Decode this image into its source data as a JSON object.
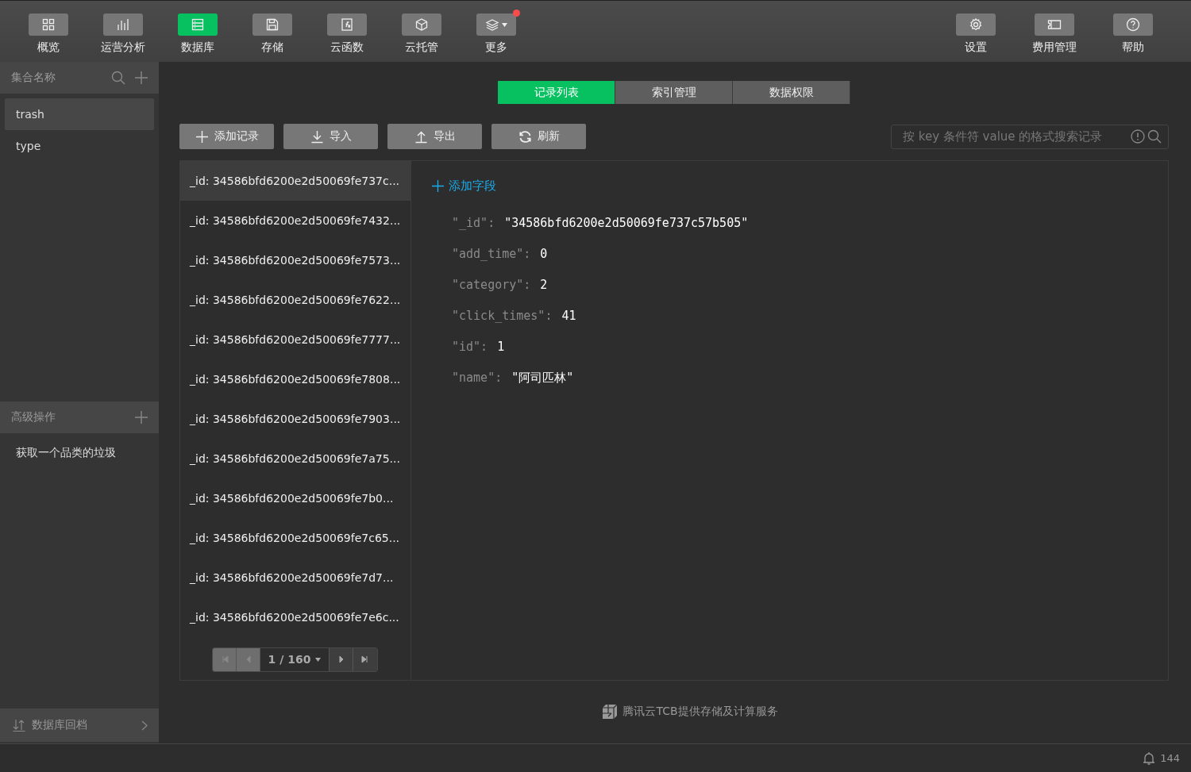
{
  "toolbar": {
    "left": [
      {
        "label": "概览",
        "selected": false,
        "badge": false,
        "dropdown": false
      },
      {
        "label": "运营分析",
        "selected": false,
        "badge": false,
        "dropdown": false
      },
      {
        "label": "数据库",
        "selected": true,
        "badge": false,
        "dropdown": false
      },
      {
        "label": "存储",
        "selected": false,
        "badge": false,
        "dropdown": false
      },
      {
        "label": "云函数",
        "selected": false,
        "badge": false,
        "dropdown": false
      },
      {
        "label": "云托管",
        "selected": false,
        "badge": false,
        "dropdown": false
      },
      {
        "label": "更多",
        "selected": false,
        "badge": true,
        "dropdown": true
      }
    ],
    "right": [
      {
        "label": "设置",
        "selected": false,
        "badge": false,
        "dropdown": false
      },
      {
        "label": "费用管理",
        "selected": false,
        "badge": false,
        "dropdown": false
      },
      {
        "label": "帮助",
        "selected": false,
        "badge": false,
        "dropdown": false
      }
    ]
  },
  "sidebar": {
    "collections_header": "集合名称",
    "collections": [
      {
        "label": "trash",
        "selected": true
      },
      {
        "label": "type",
        "selected": false
      }
    ],
    "advanced_header": "高级操作",
    "advanced": [
      {
        "label": "获取一个品类的垃圾",
        "selected": false
      }
    ],
    "rollback": "数据库回档"
  },
  "tabs": [
    {
      "label": "记录列表",
      "selected": true
    },
    {
      "label": "索引管理",
      "selected": false
    },
    {
      "label": "数据权限",
      "selected": false
    }
  ],
  "actions": [
    {
      "label": "添加记录"
    },
    {
      "label": "导入"
    },
    {
      "label": "导出"
    },
    {
      "label": "刷新"
    }
  ],
  "search": {
    "placeholder": "按 key 条件符 value 的格式搜索记录"
  },
  "records": [
    {
      "label": "_id: 34586bfd6200e2d50069fe737c...",
      "selected": true
    },
    {
      "label": "_id: 34586bfd6200e2d50069fe7432...",
      "selected": false
    },
    {
      "label": "_id: 34586bfd6200e2d50069fe7573...",
      "selected": false
    },
    {
      "label": "_id: 34586bfd6200e2d50069fe7622...",
      "selected": false
    },
    {
      "label": "_id: 34586bfd6200e2d50069fe7777...",
      "selected": false
    },
    {
      "label": "_id: 34586bfd6200e2d50069fe7808...",
      "selected": false
    },
    {
      "label": "_id: 34586bfd6200e2d50069fe7903...",
      "selected": false
    },
    {
      "label": "_id: 34586bfd6200e2d50069fe7a75...",
      "selected": false
    },
    {
      "label": "_id: 34586bfd6200e2d50069fe7b0...",
      "selected": false
    },
    {
      "label": "_id: 34586bfd6200e2d50069fe7c65...",
      "selected": false
    },
    {
      "label": "_id: 34586bfd6200e2d50069fe7d7...",
      "selected": false
    },
    {
      "label": "_id: 34586bfd6200e2d50069fe7e6c...",
      "selected": false
    }
  ],
  "pagination": {
    "page": "1 / 160",
    "first_disabled": true,
    "prev_disabled": true,
    "next_disabled": false,
    "last_disabled": false
  },
  "add_field": "添加字段",
  "fields": [
    {
      "key": "\"_id\":",
      "value": "\"34586bfd6200e2d50069fe737c57b505\""
    },
    {
      "key": "\"add_time\":",
      "value": "0"
    },
    {
      "key": "\"category\":",
      "value": "2"
    },
    {
      "key": "\"click_times\":",
      "value": "41"
    },
    {
      "key": "\"id\":",
      "value": "1"
    },
    {
      "key": "\"name\":",
      "value": "\"阿司匹林\""
    }
  ],
  "footer": "腾讯云TCB提供存储及计算服务",
  "status_bar": {
    "notifications": "144"
  }
}
